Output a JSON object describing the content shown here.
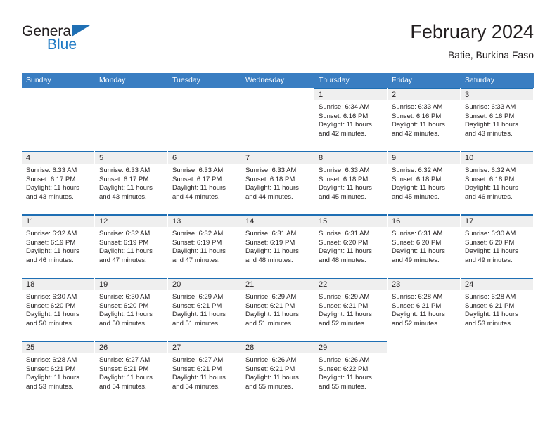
{
  "brand": {
    "logo_text_primary": "General",
    "logo_text_secondary": "Blue",
    "primary_color": "#1f6fb4",
    "header_blue": "#3a7ec2",
    "band_gray": "#efefef"
  },
  "header": {
    "title": "February 2024",
    "subtitle": "Batie, Burkina Faso"
  },
  "weekdays": [
    "Sunday",
    "Monday",
    "Tuesday",
    "Wednesday",
    "Thursday",
    "Friday",
    "Saturday"
  ],
  "calendar": {
    "month": "February",
    "year": "2024",
    "location": "Batie, Burkina Faso",
    "weeks": [
      [
        {
          "blank": true
        },
        {
          "blank": true
        },
        {
          "blank": true
        },
        {
          "blank": true
        },
        {
          "blank": false,
          "day": "1",
          "sunrise": "Sunrise: 6:34 AM",
          "sunset": "Sunset: 6:16 PM",
          "daylight1": "Daylight: 11 hours",
          "daylight2": "and 42 minutes."
        },
        {
          "blank": false,
          "day": "2",
          "sunrise": "Sunrise: 6:33 AM",
          "sunset": "Sunset: 6:16 PM",
          "daylight1": "Daylight: 11 hours",
          "daylight2": "and 42 minutes."
        },
        {
          "blank": false,
          "day": "3",
          "sunrise": "Sunrise: 6:33 AM",
          "sunset": "Sunset: 6:16 PM",
          "daylight1": "Daylight: 11 hours",
          "daylight2": "and 43 minutes."
        }
      ],
      [
        {
          "blank": false,
          "day": "4",
          "sunrise": "Sunrise: 6:33 AM",
          "sunset": "Sunset: 6:17 PM",
          "daylight1": "Daylight: 11 hours",
          "daylight2": "and 43 minutes."
        },
        {
          "blank": false,
          "day": "5",
          "sunrise": "Sunrise: 6:33 AM",
          "sunset": "Sunset: 6:17 PM",
          "daylight1": "Daylight: 11 hours",
          "daylight2": "and 43 minutes."
        },
        {
          "blank": false,
          "day": "6",
          "sunrise": "Sunrise: 6:33 AM",
          "sunset": "Sunset: 6:17 PM",
          "daylight1": "Daylight: 11 hours",
          "daylight2": "and 44 minutes."
        },
        {
          "blank": false,
          "day": "7",
          "sunrise": "Sunrise: 6:33 AM",
          "sunset": "Sunset: 6:18 PM",
          "daylight1": "Daylight: 11 hours",
          "daylight2": "and 44 minutes."
        },
        {
          "blank": false,
          "day": "8",
          "sunrise": "Sunrise: 6:33 AM",
          "sunset": "Sunset: 6:18 PM",
          "daylight1": "Daylight: 11 hours",
          "daylight2": "and 45 minutes."
        },
        {
          "blank": false,
          "day": "9",
          "sunrise": "Sunrise: 6:32 AM",
          "sunset": "Sunset: 6:18 PM",
          "daylight1": "Daylight: 11 hours",
          "daylight2": "and 45 minutes."
        },
        {
          "blank": false,
          "day": "10",
          "sunrise": "Sunrise: 6:32 AM",
          "sunset": "Sunset: 6:18 PM",
          "daylight1": "Daylight: 11 hours",
          "daylight2": "and 46 minutes."
        }
      ],
      [
        {
          "blank": false,
          "day": "11",
          "sunrise": "Sunrise: 6:32 AM",
          "sunset": "Sunset: 6:19 PM",
          "daylight1": "Daylight: 11 hours",
          "daylight2": "and 46 minutes."
        },
        {
          "blank": false,
          "day": "12",
          "sunrise": "Sunrise: 6:32 AM",
          "sunset": "Sunset: 6:19 PM",
          "daylight1": "Daylight: 11 hours",
          "daylight2": "and 47 minutes."
        },
        {
          "blank": false,
          "day": "13",
          "sunrise": "Sunrise: 6:32 AM",
          "sunset": "Sunset: 6:19 PM",
          "daylight1": "Daylight: 11 hours",
          "daylight2": "and 47 minutes."
        },
        {
          "blank": false,
          "day": "14",
          "sunrise": "Sunrise: 6:31 AM",
          "sunset": "Sunset: 6:19 PM",
          "daylight1": "Daylight: 11 hours",
          "daylight2": "and 48 minutes."
        },
        {
          "blank": false,
          "day": "15",
          "sunrise": "Sunrise: 6:31 AM",
          "sunset": "Sunset: 6:20 PM",
          "daylight1": "Daylight: 11 hours",
          "daylight2": "and 48 minutes."
        },
        {
          "blank": false,
          "day": "16",
          "sunrise": "Sunrise: 6:31 AM",
          "sunset": "Sunset: 6:20 PM",
          "daylight1": "Daylight: 11 hours",
          "daylight2": "and 49 minutes."
        },
        {
          "blank": false,
          "day": "17",
          "sunrise": "Sunrise: 6:30 AM",
          "sunset": "Sunset: 6:20 PM",
          "daylight1": "Daylight: 11 hours",
          "daylight2": "and 49 minutes."
        }
      ],
      [
        {
          "blank": false,
          "day": "18",
          "sunrise": "Sunrise: 6:30 AM",
          "sunset": "Sunset: 6:20 PM",
          "daylight1": "Daylight: 11 hours",
          "daylight2": "and 50 minutes."
        },
        {
          "blank": false,
          "day": "19",
          "sunrise": "Sunrise: 6:30 AM",
          "sunset": "Sunset: 6:20 PM",
          "daylight1": "Daylight: 11 hours",
          "daylight2": "and 50 minutes."
        },
        {
          "blank": false,
          "day": "20",
          "sunrise": "Sunrise: 6:29 AM",
          "sunset": "Sunset: 6:21 PM",
          "daylight1": "Daylight: 11 hours",
          "daylight2": "and 51 minutes."
        },
        {
          "blank": false,
          "day": "21",
          "sunrise": "Sunrise: 6:29 AM",
          "sunset": "Sunset: 6:21 PM",
          "daylight1": "Daylight: 11 hours",
          "daylight2": "and 51 minutes."
        },
        {
          "blank": false,
          "day": "22",
          "sunrise": "Sunrise: 6:29 AM",
          "sunset": "Sunset: 6:21 PM",
          "daylight1": "Daylight: 11 hours",
          "daylight2": "and 52 minutes."
        },
        {
          "blank": false,
          "day": "23",
          "sunrise": "Sunrise: 6:28 AM",
          "sunset": "Sunset: 6:21 PM",
          "daylight1": "Daylight: 11 hours",
          "daylight2": "and 52 minutes."
        },
        {
          "blank": false,
          "day": "24",
          "sunrise": "Sunrise: 6:28 AM",
          "sunset": "Sunset: 6:21 PM",
          "daylight1": "Daylight: 11 hours",
          "daylight2": "and 53 minutes."
        }
      ],
      [
        {
          "blank": false,
          "day": "25",
          "sunrise": "Sunrise: 6:28 AM",
          "sunset": "Sunset: 6:21 PM",
          "daylight1": "Daylight: 11 hours",
          "daylight2": "and 53 minutes."
        },
        {
          "blank": false,
          "day": "26",
          "sunrise": "Sunrise: 6:27 AM",
          "sunset": "Sunset: 6:21 PM",
          "daylight1": "Daylight: 11 hours",
          "daylight2": "and 54 minutes."
        },
        {
          "blank": false,
          "day": "27",
          "sunrise": "Sunrise: 6:27 AM",
          "sunset": "Sunset: 6:21 PM",
          "daylight1": "Daylight: 11 hours",
          "daylight2": "and 54 minutes."
        },
        {
          "blank": false,
          "day": "28",
          "sunrise": "Sunrise: 6:26 AM",
          "sunset": "Sunset: 6:21 PM",
          "daylight1": "Daylight: 11 hours",
          "daylight2": "and 55 minutes."
        },
        {
          "blank": false,
          "day": "29",
          "sunrise": "Sunrise: 6:26 AM",
          "sunset": "Sunset: 6:22 PM",
          "daylight1": "Daylight: 11 hours",
          "daylight2": "and 55 minutes."
        },
        {
          "blank": true,
          "tail": true
        },
        {
          "blank": true,
          "tail": true
        }
      ]
    ]
  }
}
